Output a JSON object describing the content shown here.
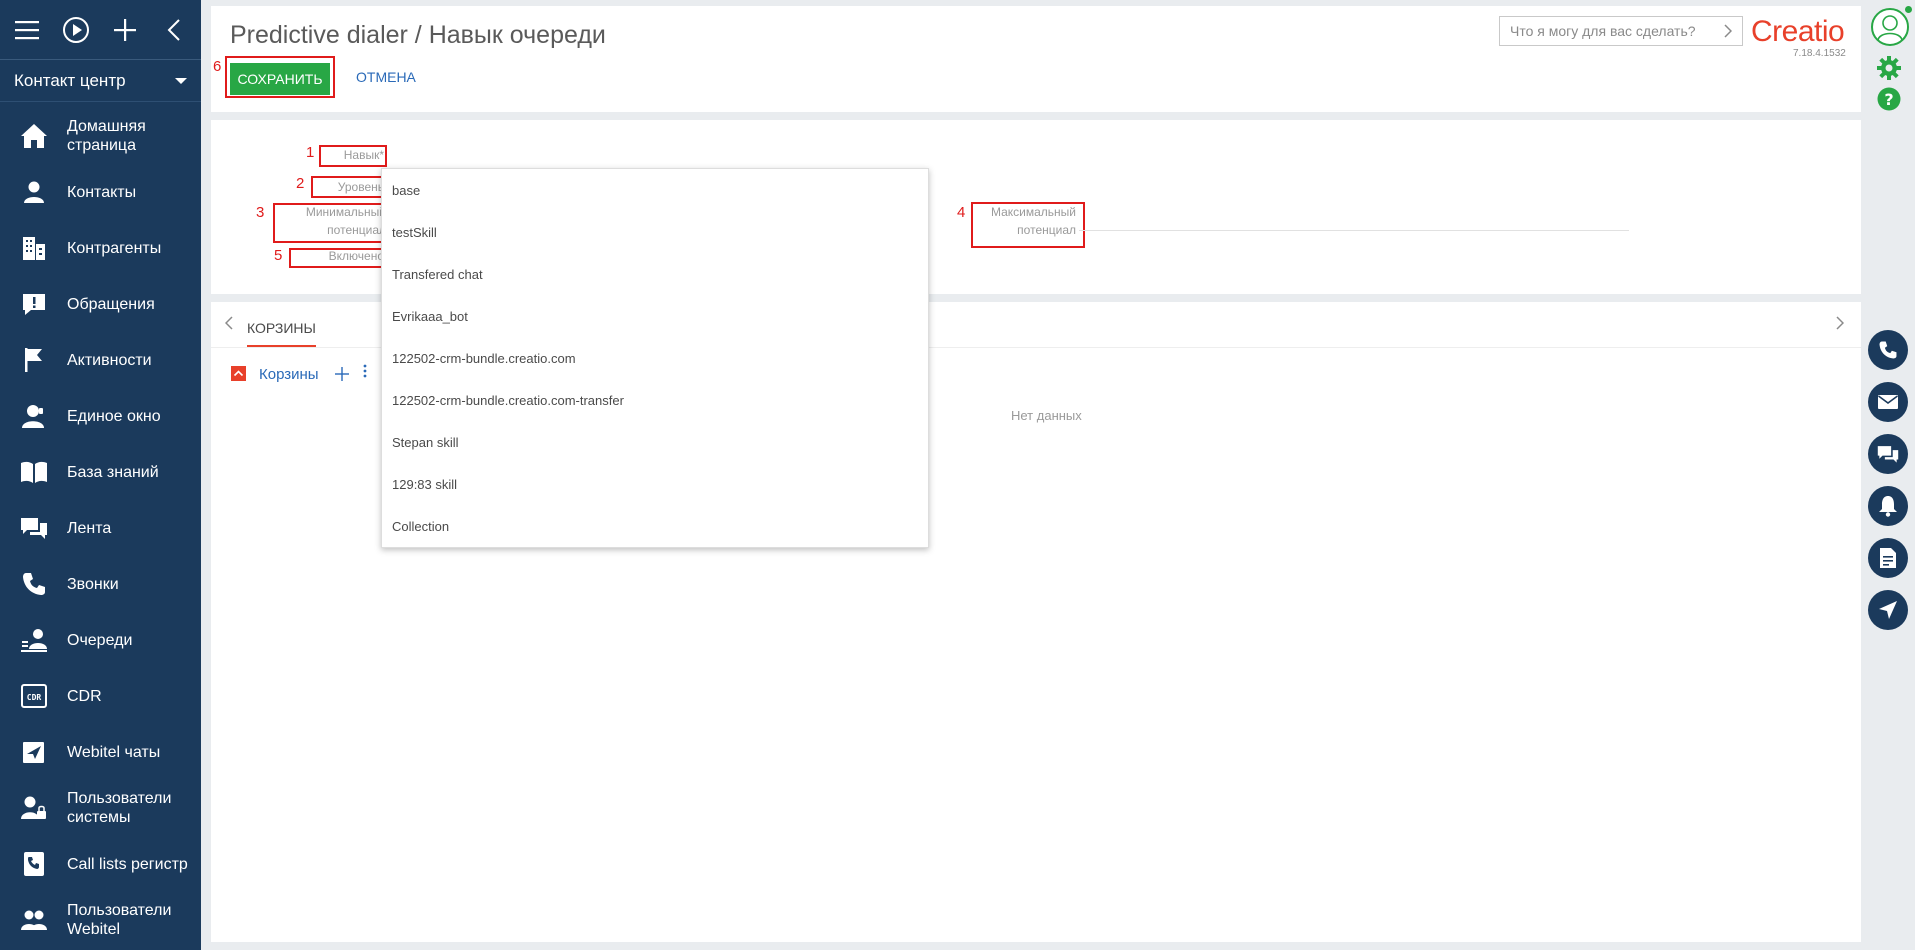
{
  "sidebar": {
    "workspace": "Контакт центр",
    "items": [
      {
        "label": "Домашняя страница",
        "icon": "home-icon"
      },
      {
        "label": "Контакты",
        "icon": "person-icon"
      },
      {
        "label": "Контрагенты",
        "icon": "building-icon"
      },
      {
        "label": "Обращения",
        "icon": "exclamation-icon"
      },
      {
        "label": "Активности",
        "icon": "flag-icon"
      },
      {
        "label": "Единое окно",
        "icon": "agent-icon"
      },
      {
        "label": "База знаний",
        "icon": "book-icon"
      },
      {
        "label": "Лента",
        "icon": "feed-icon"
      },
      {
        "label": "Звонки",
        "icon": "phone-icon"
      },
      {
        "label": "Очереди",
        "icon": "queue-icon"
      },
      {
        "label": "CDR",
        "icon": "cdr-icon"
      },
      {
        "label": "Webitel чаты",
        "icon": "chat-send-icon"
      },
      {
        "label": "Пользователи системы",
        "icon": "user-lock-icon"
      },
      {
        "label": "Call lists регистр",
        "icon": "call-list-icon"
      },
      {
        "label": "Пользователи Webitel",
        "icon": "users-icon"
      }
    ]
  },
  "header": {
    "title": "Predictive dialer / Навык очереди",
    "save_label": "СОХРАНИТЬ",
    "cancel_label": "ОТМЕНА",
    "search_placeholder": "Что я могу для вас сделать?",
    "logo_text": "Creatio",
    "version": "7.18.4.1532"
  },
  "annotations": {
    "n1": "1",
    "n2": "2",
    "n3": "3",
    "n4": "4",
    "n5": "5",
    "n6": "6"
  },
  "form": {
    "skill_label": "Навык*",
    "level_label": "Уровень",
    "min_capacity_label_1": "Минимальный",
    "min_capacity_label_2": "потенциал",
    "max_capacity_label_1": "Максимальный",
    "max_capacity_label_2": "потенциал",
    "enabled_label": "Включено"
  },
  "tabs": {
    "baskets_tab": "КОРЗИНЫ",
    "detail_title": "Корзины",
    "no_data": "Нет данных"
  },
  "dropdown": {
    "options": [
      "base",
      "testSkill",
      "Transfered chat",
      "Evrikaaa_bot",
      "122502-crm-bundle.creatio.com",
      "122502-crm-bundle.creatio.com-transfer",
      "Stepan skill",
      "129:83 skill",
      "Collection"
    ]
  },
  "colors": {
    "sidebar_bg": "#1b3a5c",
    "save_green": "#28a745",
    "accent_red": "#e8402a",
    "link_blue": "#2a6ab8",
    "annotation_red": "#e01b1b"
  }
}
